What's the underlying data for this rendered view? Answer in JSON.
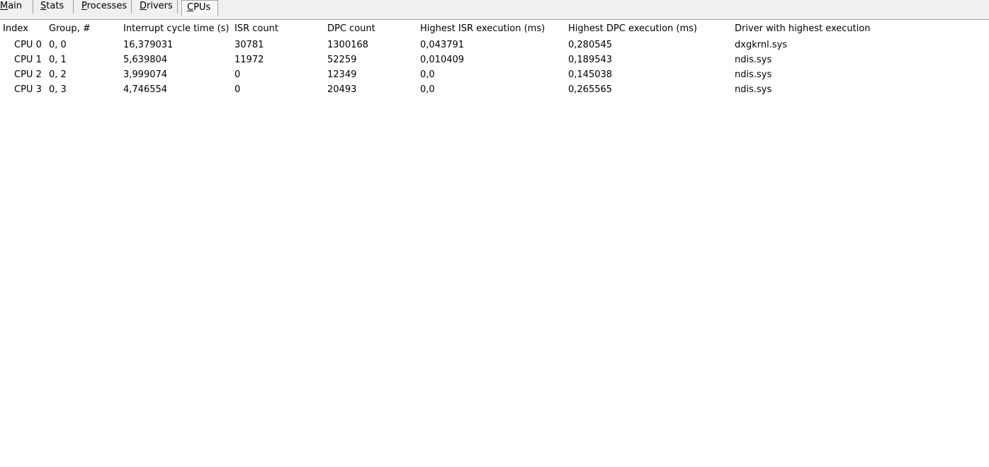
{
  "tabs": [
    {
      "pre": "",
      "mnemonic": "M",
      "post": "ain",
      "active": false
    },
    {
      "pre": "",
      "mnemonic": "S",
      "post": "tats",
      "active": false
    },
    {
      "pre": "",
      "mnemonic": "P",
      "post": "rocesses",
      "active": false
    },
    {
      "pre": "",
      "mnemonic": "D",
      "post": "rivers",
      "active": false
    },
    {
      "pre": "",
      "mnemonic": "C",
      "post": "PUs",
      "active": true
    }
  ],
  "table": {
    "columns": [
      "Index",
      "Group, #",
      "Interrupt cycle time (s)",
      "ISR count",
      "DPC count",
      "Highest ISR execution (ms)",
      "Highest DPC execution (ms)",
      "Driver with highest execution"
    ],
    "rows": [
      [
        "CPU 0",
        "0, 0",
        "16,379031",
        "30781",
        "1300168",
        "0,043791",
        "0,280545",
        "dxgkrnl.sys"
      ],
      [
        "CPU 1",
        "0, 1",
        "5,639804",
        "11972",
        "52259",
        "0,010409",
        "0,189543",
        "ndis.sys"
      ],
      [
        "CPU 2",
        "0, 2",
        "3,999074",
        "0",
        "12349",
        "0,0",
        "0,145038",
        "ndis.sys"
      ],
      [
        "CPU 3",
        "0, 3",
        "4,746554",
        "0",
        "20493",
        "0,0",
        "0,265565",
        "ndis.sys"
      ]
    ]
  }
}
